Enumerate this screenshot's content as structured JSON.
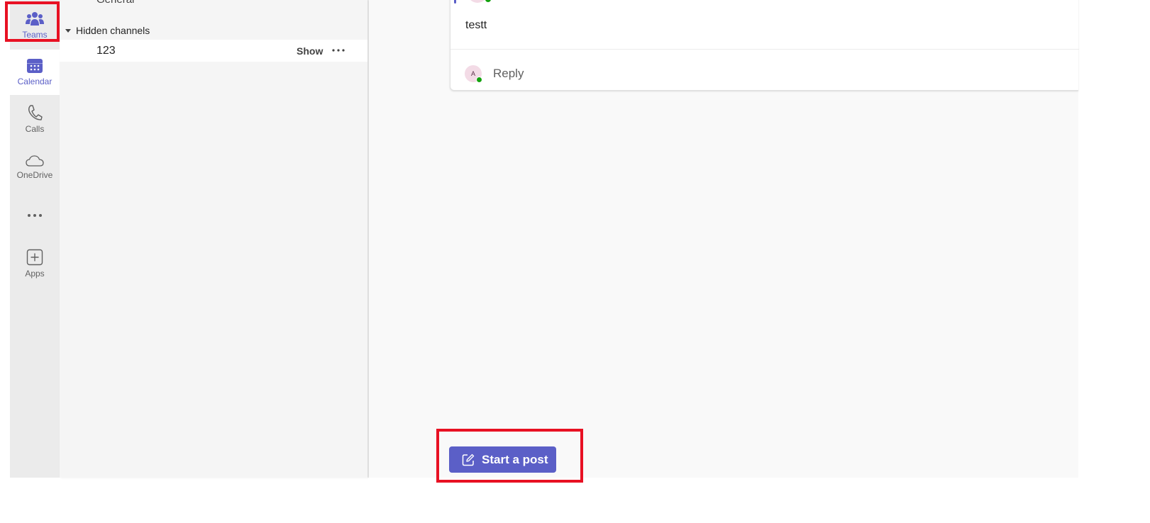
{
  "rail": {
    "items": [
      {
        "label": "Teams",
        "icon": "teams-icon",
        "active": true
      },
      {
        "label": "Calendar",
        "icon": "calendar-icon",
        "active": true
      },
      {
        "label": "Calls",
        "icon": "phone-icon",
        "active": false
      },
      {
        "label": "OneDrive",
        "icon": "cloud-icon",
        "active": false
      },
      {
        "label": "",
        "icon": "more-horizontal-icon",
        "active": false
      },
      {
        "label": "Apps",
        "icon": "add-app-icon",
        "active": false
      }
    ]
  },
  "channels": {
    "partial_item": "General",
    "hidden_section_label": "Hidden channels",
    "hidden_items": [
      {
        "name": "123",
        "show_label": "Show"
      }
    ]
  },
  "post": {
    "message": "testt",
    "reply_avatar_initial": "A",
    "reply_label": "Reply"
  },
  "compose": {
    "start_post_label": "Start a post"
  },
  "colors": {
    "accent": "#5b5fc7",
    "presence": "#13a10e",
    "highlight": "#e81123"
  }
}
